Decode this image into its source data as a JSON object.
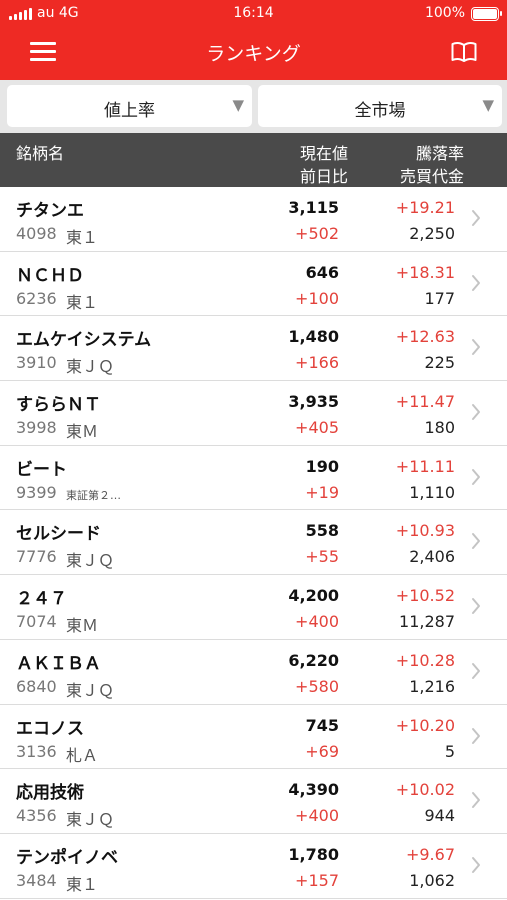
{
  "status_bar": {
    "carrier": "au 4G",
    "time": "16:14",
    "battery": "100%"
  },
  "nav": {
    "title": "ランキング",
    "menu_icon": "hamburger-menu-icon",
    "book_icon": "open-book-icon"
  },
  "filters": {
    "ranking_type": "値上率",
    "market": "全市場"
  },
  "header": {
    "name": "銘柄名",
    "price": "現在値",
    "change": "前日比",
    "rate": "騰落率",
    "volume": "売買代金"
  },
  "colors": {
    "brand_red": "#ee2a24",
    "positive": "#e3423b",
    "header_bg": "#4a4a4a"
  },
  "stocks": [
    {
      "name": "チタンエ",
      "code": "4098",
      "market": "東１",
      "price": "3,115",
      "change": "+502",
      "rate": "+19.21",
      "volume": "2,250"
    },
    {
      "name": "ＮＣＨＤ",
      "code": "6236",
      "market": "東１",
      "price": "646",
      "change": "+100",
      "rate": "+18.31",
      "volume": "177"
    },
    {
      "name": "エムケイシステム",
      "code": "3910",
      "market": "東ＪＱ",
      "price": "1,480",
      "change": "+166",
      "rate": "+12.63",
      "volume": "225"
    },
    {
      "name": "すららＮＴ",
      "code": "3998",
      "market": "東Ｍ",
      "price": "3,935",
      "change": "+405",
      "rate": "+11.47",
      "volume": "180"
    },
    {
      "name": "ビート",
      "code": "9399",
      "market": "東証第２…",
      "price": "190",
      "change": "+19",
      "rate": "+11.11",
      "volume": "1,110"
    },
    {
      "name": "セルシード",
      "code": "7776",
      "market": "東ＪＱ",
      "price": "558",
      "change": "+55",
      "rate": "+10.93",
      "volume": "2,406"
    },
    {
      "name": "２４７",
      "code": "7074",
      "market": "東Ｍ",
      "price": "4,200",
      "change": "+400",
      "rate": "+10.52",
      "volume": "11,287"
    },
    {
      "name": "ＡＫＩＢＡ",
      "code": "6840",
      "market": "東ＪＱ",
      "price": "6,220",
      "change": "+580",
      "rate": "+10.28",
      "volume": "1,216"
    },
    {
      "name": "エコノス",
      "code": "3136",
      "market": "札Ａ",
      "price": "745",
      "change": "+69",
      "rate": "+10.20",
      "volume": "5"
    },
    {
      "name": "応用技術",
      "code": "4356",
      "market": "東ＪＱ",
      "price": "4,390",
      "change": "+400",
      "rate": "+10.02",
      "volume": "944"
    },
    {
      "name": "テンポイノベ",
      "code": "3484",
      "market": "東１",
      "price": "1,780",
      "change": "+157",
      "rate": "+9.67",
      "volume": "1,062"
    }
  ]
}
